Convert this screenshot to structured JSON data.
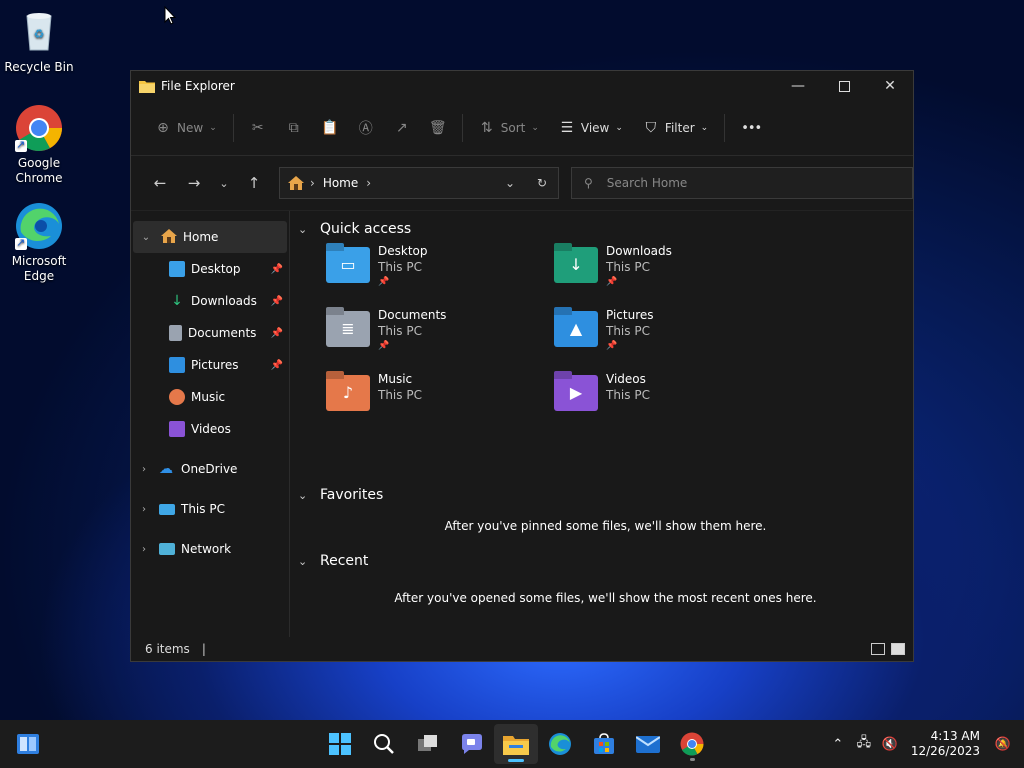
{
  "desktop": {
    "icons": [
      {
        "label": "Recycle Bin"
      },
      {
        "label": "Google Chrome"
      },
      {
        "label": "Microsoft Edge"
      }
    ]
  },
  "window": {
    "title": "File Explorer",
    "toolbar": {
      "new_label": "New",
      "sort_label": "Sort",
      "view_label": "View",
      "filter_label": "Filter",
      "more_label": "•••"
    },
    "address": {
      "crumb": "Home"
    },
    "search": {
      "placeholder": "Search Home"
    },
    "sidebar": {
      "home": "Home",
      "pinned": [
        {
          "label": "Desktop",
          "pin": "📌"
        },
        {
          "label": "Downloads",
          "pin": "📌"
        },
        {
          "label": "Documents",
          "pin": "📌"
        },
        {
          "label": "Pictures",
          "pin": "📌"
        },
        {
          "label": "Music"
        },
        {
          "label": "Videos"
        }
      ],
      "onedrive": "OneDrive",
      "thispc": "This PC",
      "network": "Network"
    },
    "content": {
      "quick_access_title": "Quick access",
      "quick_access": [
        {
          "name": "Desktop",
          "location": "This PC",
          "pinned": "📌",
          "color": "#3aa0e8"
        },
        {
          "name": "Downloads",
          "location": "This PC",
          "pinned": "📌",
          "color": "#1f9e7a"
        },
        {
          "name": "Documents",
          "location": "This PC",
          "pinned": "📌",
          "color": "#9aa3b0"
        },
        {
          "name": "Pictures",
          "location": "This PC",
          "pinned": "📌",
          "color": "#2e8fe0"
        },
        {
          "name": "Music",
          "location": "This PC",
          "color": "#e5784a"
        },
        {
          "name": "Videos",
          "location": "This PC",
          "color": "#8a53d6"
        }
      ],
      "favorites_title": "Favorites",
      "favorites_empty": "After you've pinned some files, we'll show them here.",
      "recent_title": "Recent",
      "recent_empty": "After you've opened some files, we'll show the most recent ones here."
    },
    "status": {
      "items": "6 items",
      "cursor": "|"
    }
  },
  "taskbar": {
    "time": "4:13 AM",
    "date": "12/26/2023"
  }
}
